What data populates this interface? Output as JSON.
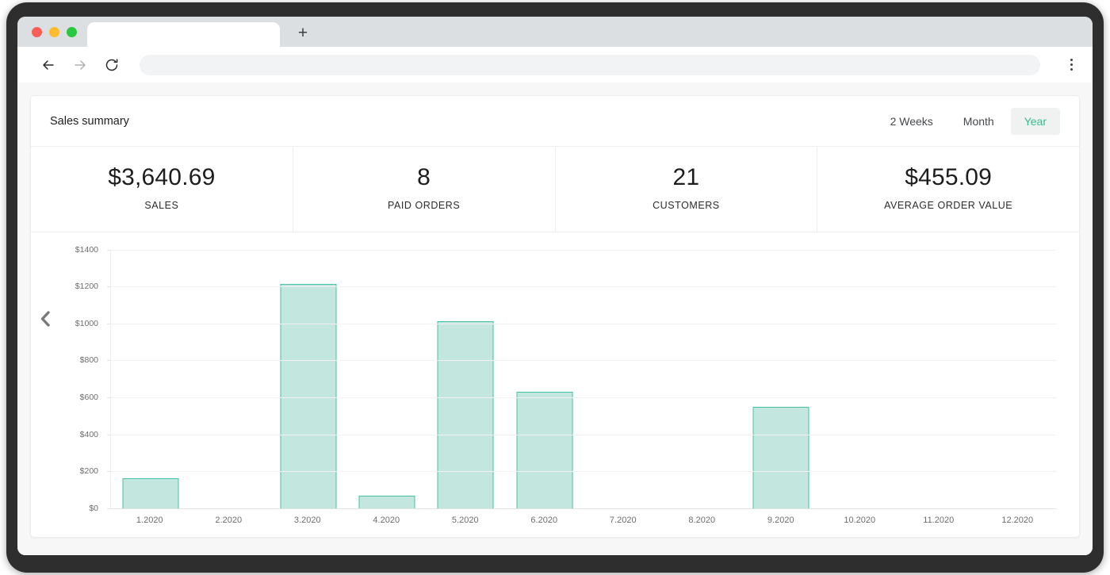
{
  "browser": {
    "tab_title": "",
    "new_tab_label": "+",
    "address_value": "",
    "icons": {
      "back": "arrow-left-icon",
      "forward": "arrow-right-icon",
      "reload": "reload-icon",
      "menu": "kebab-menu-icon"
    },
    "traffic_lights": [
      "close-red",
      "minimize-yellow",
      "maximize-green"
    ]
  },
  "card": {
    "title": "Sales summary",
    "periods": [
      {
        "label": "2 Weeks",
        "active": false
      },
      {
        "label": "Month",
        "active": false
      },
      {
        "label": "Year",
        "active": true
      }
    ],
    "active_accent": "#2fc08c"
  },
  "stats": [
    {
      "value": "$3,640.69",
      "label": "SALES"
    },
    {
      "value": "8",
      "label": "PAID ORDERS"
    },
    {
      "value": "21",
      "label": "CUSTOMERS"
    },
    {
      "value": "$455.09",
      "label": "AVERAGE ORDER VALUE"
    }
  ],
  "nav": {
    "prev_icon": "chevron-left-icon"
  },
  "chart_data": {
    "type": "bar",
    "title": "",
    "xlabel": "",
    "ylabel": "",
    "categories": [
      "1.2020",
      "2.2020",
      "3.2020",
      "4.2020",
      "5.2020",
      "6.2020",
      "7.2020",
      "8.2020",
      "9.2020",
      "10.2020",
      "11.2020",
      "12.2020"
    ],
    "values": [
      162,
      0,
      1212,
      68,
      1012,
      632,
      0,
      0,
      548,
      0,
      0,
      0
    ],
    "ylim": [
      0,
      1400
    ],
    "yticks": [
      0,
      200,
      400,
      600,
      800,
      1000,
      1200,
      1400
    ],
    "ytick_labels": [
      "$0",
      "$200",
      "$400",
      "$600",
      "$800",
      "$1000",
      "$1200",
      "$1400"
    ],
    "grid": true,
    "legend": false,
    "bar_fill": "#c3e7de",
    "bar_stroke": "#44c2a5"
  }
}
